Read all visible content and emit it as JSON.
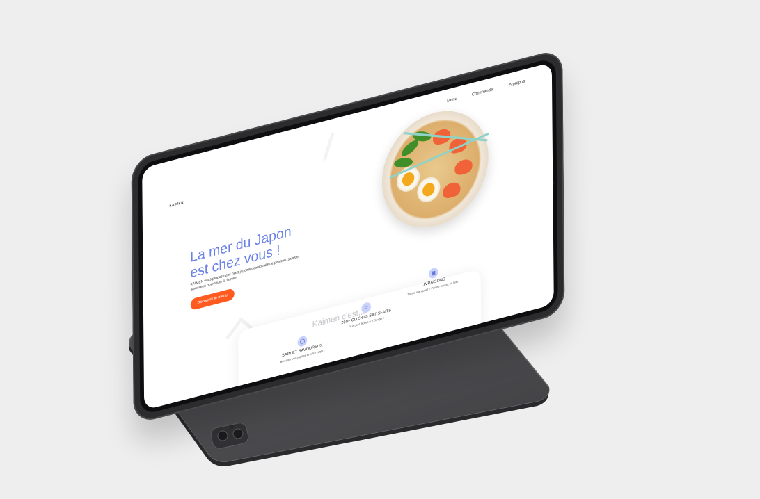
{
  "site": {
    "brand": "KAIMEN",
    "nav": [
      "Menu",
      "Commander",
      "A propos"
    ],
    "hero": {
      "title_line1": "La mer du Japon",
      "title_line2": "est chez vous !",
      "description": "KAIMEN vous propose des plats japonais composés de poisson, sains et savoureux pour toute la famille.",
      "cta_label": "Découvrir le menu"
    },
    "section_title": "Kaimen c'est...",
    "features": [
      {
        "icon": "bowl-icon",
        "title": "SAIN ET SAVOUREUX",
        "text": "Bon pour vos papilles et votre corps !"
      },
      {
        "icon": "star-icon",
        "title": "200+ CLIENTS SATISFAITS",
        "text": "Plus de 4 étoiles sur Google !"
      },
      {
        "icon": "qr-code-icon",
        "title": "LIVRAISONS",
        "text": "Temps manquant ? Pas de soucis, on livre !"
      }
    ]
  },
  "colors": {
    "background": "#eeeeee",
    "accent_title": "#6a82e6",
    "cta": "#ff5a1f",
    "icon_badge": "#c9d2fb",
    "device": "#2c2c2e"
  }
}
